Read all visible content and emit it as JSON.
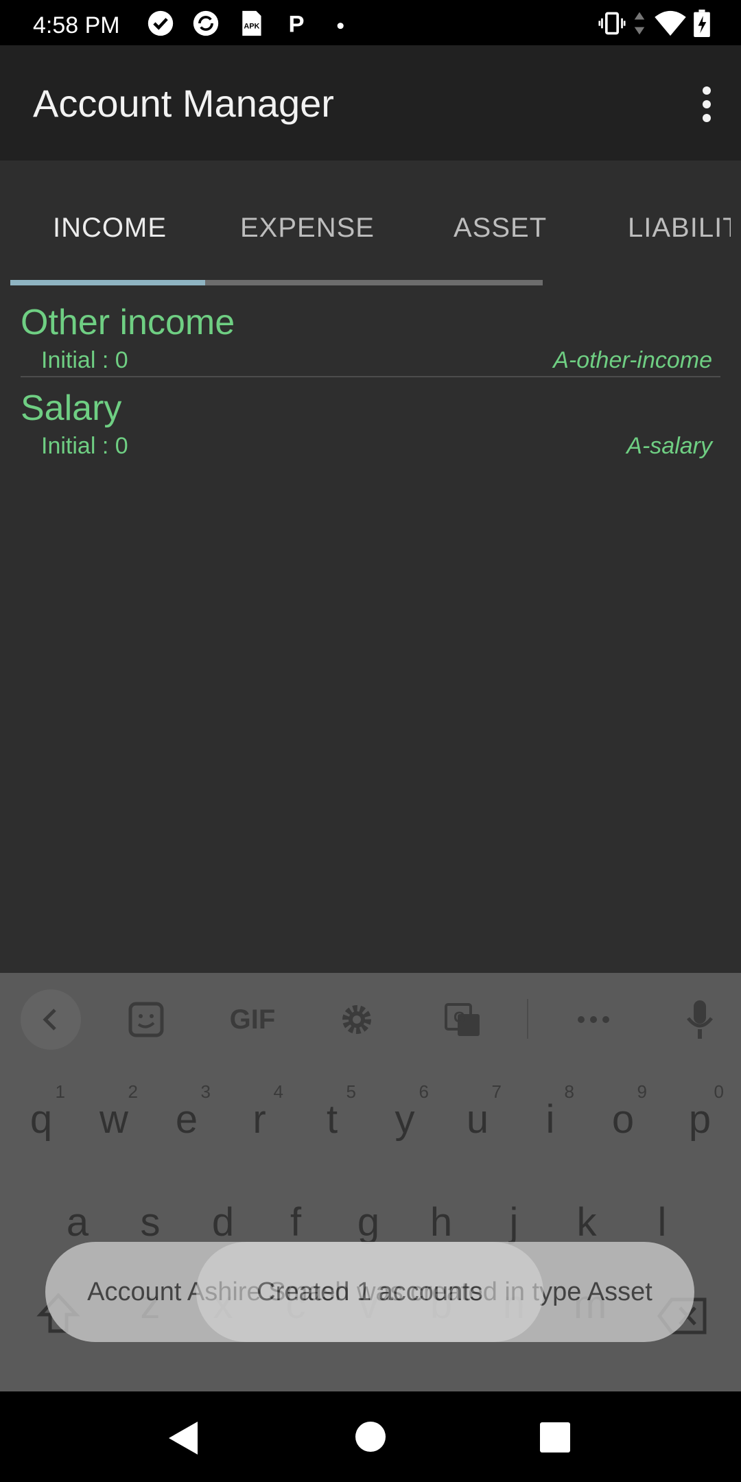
{
  "status_bar": {
    "time": "4:58 PM",
    "left_icons": [
      "check-circle-icon",
      "sync-icon",
      "apk-icon",
      "p-icon",
      "dot-icon"
    ],
    "apk_label": "APK",
    "p_label": "P",
    "right_icons": [
      "vibrate-icon",
      "data-arrows-icon",
      "wifi-icon",
      "battery-charging-icon"
    ]
  },
  "app_bar": {
    "title": "Account Manager",
    "menu_icon": "more-vert-icon"
  },
  "tabs": [
    {
      "label": "INCOME",
      "active": true
    },
    {
      "label": "EXPENSE",
      "active": false
    },
    {
      "label": "ASSET",
      "active": false
    },
    {
      "label": "LIABILIT",
      "active": false
    }
  ],
  "accounts": [
    {
      "name": "Other income",
      "initial": "Initial : 0",
      "code": "A-other-income"
    },
    {
      "name": "Salary",
      "initial": "Initial : 0",
      "code": "A-salary"
    }
  ],
  "keyboard": {
    "toolbar": [
      "chevron-left-icon",
      "sticker-icon",
      "gif-icon",
      "gear-icon",
      "translate-icon",
      "more-horiz-icon",
      "mic-icon"
    ],
    "gif_label": "GIF",
    "row1": [
      {
        "key": "q",
        "hint": "1"
      },
      {
        "key": "w",
        "hint": "2"
      },
      {
        "key": "e",
        "hint": "3"
      },
      {
        "key": "r",
        "hint": "4"
      },
      {
        "key": "t",
        "hint": "5"
      },
      {
        "key": "y",
        "hint": "6"
      },
      {
        "key": "u",
        "hint": "7"
      },
      {
        "key": "i",
        "hint": "8"
      },
      {
        "key": "o",
        "hint": "9"
      },
      {
        "key": "p",
        "hint": "0"
      }
    ],
    "row2": [
      "a",
      "s",
      "d",
      "f",
      "g",
      "h",
      "j",
      "k",
      "l"
    ],
    "row3": [
      "z",
      "x",
      "c",
      "v",
      "b",
      "n",
      "m"
    ],
    "shift_icon": "shift-icon",
    "backspace_icon": "backspace-icon"
  },
  "toasts": [
    {
      "text": "Account Ashire Smash was created in type Asset"
    },
    {
      "text": "Created 1 accounts"
    }
  ],
  "nav_bar": {
    "icons": [
      "back-triangle-icon",
      "home-circle-icon",
      "recents-square-icon"
    ]
  },
  "colors": {
    "accent_green": "#6fcf83",
    "background": "#2e2e2e",
    "app_bar": "#212121",
    "tab_indicator": "#8fb4c2"
  }
}
